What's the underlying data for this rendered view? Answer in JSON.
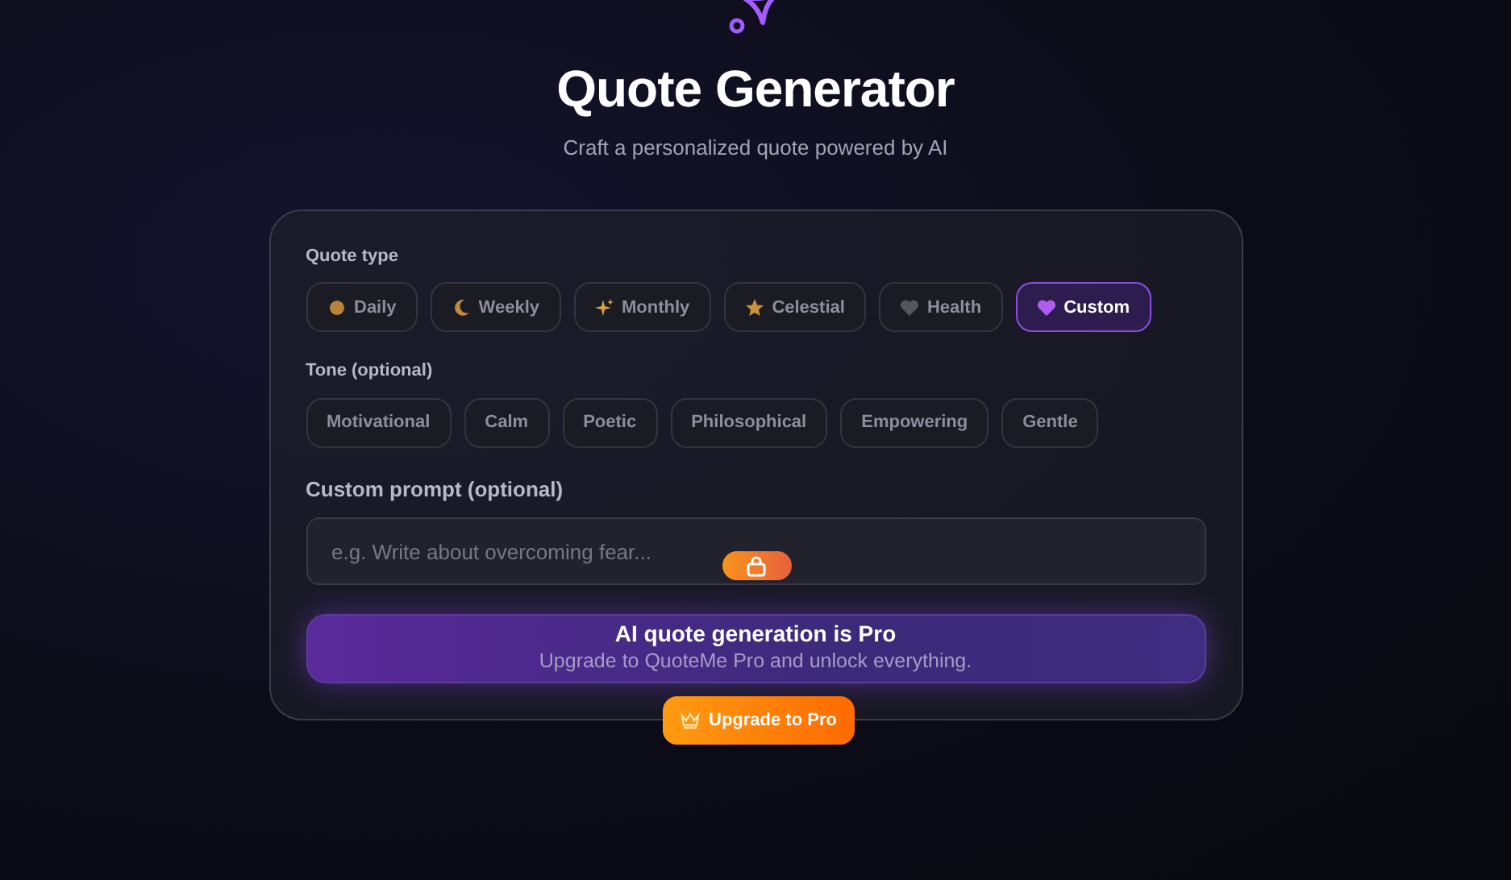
{
  "header": {
    "title": "Quote Generator",
    "subtitle": "Craft a personalized quote powered by AI"
  },
  "quote_type": {
    "label": "Quote type",
    "options": [
      {
        "label": "Daily",
        "selected": false
      },
      {
        "label": "Weekly",
        "selected": false
      },
      {
        "label": "Monthly",
        "selected": false
      },
      {
        "label": "Celestial",
        "selected": false
      },
      {
        "label": "Health",
        "selected": false
      },
      {
        "label": "Custom",
        "selected": true
      }
    ]
  },
  "tone": {
    "label": "Tone (optional)",
    "options": [
      {
        "label": "Motivational",
        "selected": false
      },
      {
        "label": "Calm",
        "selected": false
      },
      {
        "label": "Poetic",
        "selected": false
      },
      {
        "label": "Philosophical",
        "selected": false
      },
      {
        "label": "Empowering",
        "selected": false
      },
      {
        "label": "Gentle",
        "selected": false
      }
    ]
  },
  "custom_prompt": {
    "label": "Custom prompt (optional)",
    "placeholder": "e.g. Write about overcoming fear...",
    "locked": true
  },
  "pro_banner": {
    "title": "AI quote generation is Pro",
    "text": "Upgrade to QuoteMe Pro and unlock everything."
  },
  "upgrade_button": "Upgrade to Pro"
}
